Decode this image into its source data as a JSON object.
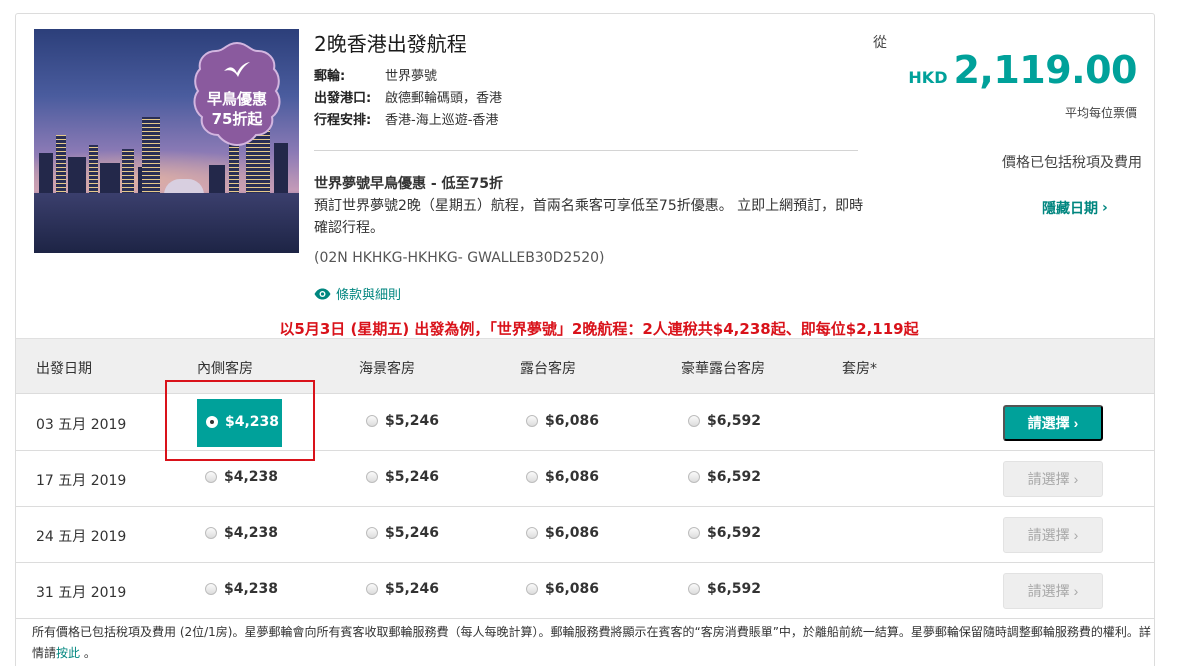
{
  "cruise": {
    "title": "2晚香港出發航程",
    "details": [
      {
        "label": "郵輪:",
        "value": "世界夢號"
      },
      {
        "label": "出發港口:",
        "value": "啟德郵輪碼頭，香港"
      },
      {
        "label": "行程安排:",
        "value": "香港-海上巡遊-香港"
      }
    ],
    "badge": {
      "line1": "早鳥優惠",
      "line2": "75折起",
      "icon": "seagull-icon"
    },
    "promo_title": "世界夢號早鳥優惠 - 低至75折",
    "promo_desc": "預訂世界夢號2晚（星期五）航程，首兩名乘客可享低至75折優惠。 立即上網預訂，即時確認行程。",
    "code": "(02N HKHKG-HKHKG- GWALLEB30D2520)",
    "terms_label": "條款與細則"
  },
  "pricing": {
    "from_label": "從",
    "currency": "HKD",
    "amount": "2,119.00",
    "avg_label": "平均每位票價",
    "tax_label": "價格已包括稅項及費用",
    "hide_dates_label": "隱藏日期"
  },
  "headline": "以5月3日 (星期五) 出發為例，「世界夢號」2晚航程：2人連稅共$4,238起、即每位$2,119起",
  "table": {
    "headers": [
      "出發日期",
      "內側客房",
      "海景客房",
      "露台客房",
      "豪華露台客房",
      "套房*"
    ],
    "choose_label": "請選擇",
    "rows": [
      {
        "date": "03 五月 2019",
        "prices": [
          "$4,238",
          "$5,246",
          "$6,086",
          "$6,592"
        ],
        "selected": true
      },
      {
        "date": "17 五月 2019",
        "prices": [
          "$4,238",
          "$5,246",
          "$6,086",
          "$6,592"
        ],
        "selected": false
      },
      {
        "date": "24 五月 2019",
        "prices": [
          "$4,238",
          "$5,246",
          "$6,086",
          "$6,592"
        ],
        "selected": false
      },
      {
        "date": "31 五月 2019",
        "prices": [
          "$4,238",
          "$5,246",
          "$6,086",
          "$6,592"
        ],
        "selected": false
      }
    ]
  },
  "footnote": {
    "text": "所有價格已包括稅項及費用 (2位/1房)。星夢郵輪會向所有賓客收取郵輪服務費（每人每晚計算）。郵輪服務費將顯示在賓客的“客房消費賬單”中，於離船前統一結算。星夢郵輪保留隨時調整郵輪服務費的權利。詳情請",
    "link": "按此",
    "end": " 。"
  },
  "colors": {
    "accent": "#00a19a",
    "headline": "#d9121a",
    "badge": "#8a5a9e"
  }
}
